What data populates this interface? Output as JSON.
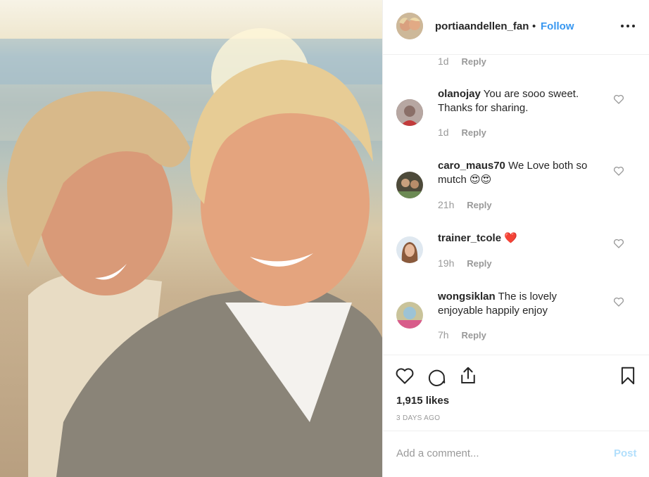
{
  "post": {
    "author": {
      "username": "portiaandellen_fan",
      "separator": "•",
      "follow_label": "Follow"
    },
    "more_icon": "more-horizontal-icon",
    "top_meta": {
      "time": "1d",
      "reply": "Reply"
    },
    "comments": [
      {
        "username": "olanojay",
        "text": "You are sooo sweet. Thanks for sharing.",
        "time": "1d",
        "reply": "Reply"
      },
      {
        "username": "caro_maus70",
        "text": "We Love both so mutch 😍😍",
        "time": "21h",
        "reply": "Reply"
      },
      {
        "username": "trainer_tcole",
        "text": "❤️",
        "time": "19h",
        "reply": "Reply"
      },
      {
        "username": "wongsiklan",
        "text": "The is lovely enjoyable happily enjoy",
        "time": "7h",
        "reply": "Reply"
      }
    ],
    "likes": "1,915 likes",
    "date": "3 DAYS AGO",
    "add_comment": {
      "placeholder": "Add a comment...",
      "post_label": "Post"
    },
    "colors": {
      "accent": "#3897f0",
      "muted": "#999999",
      "post_disabled": "#b2dffc",
      "heart": "#ed4956"
    }
  }
}
